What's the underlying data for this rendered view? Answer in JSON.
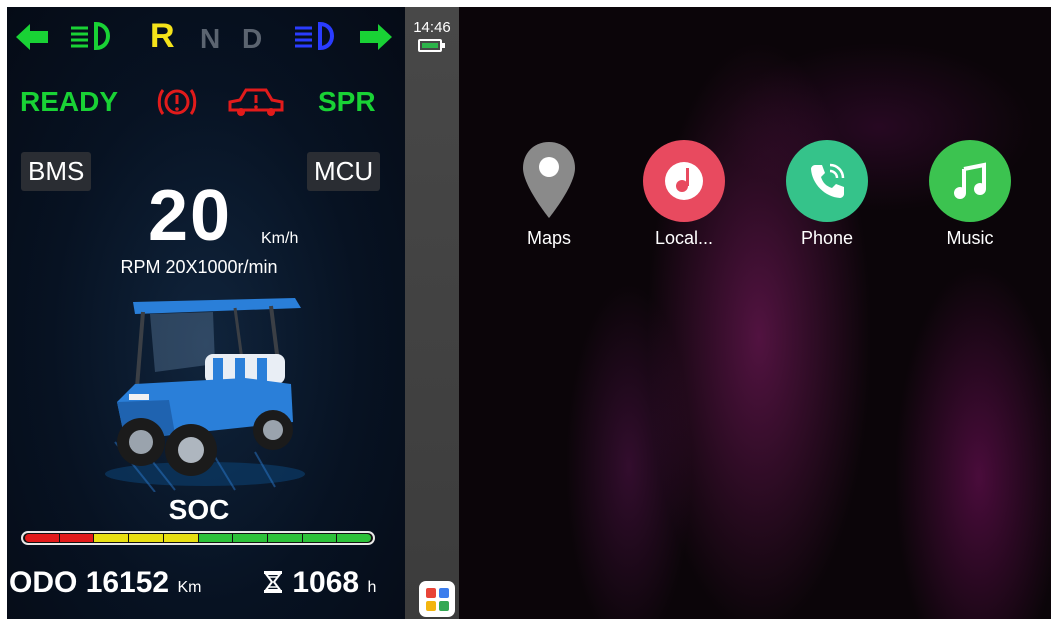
{
  "indicators": {
    "gear_r": "R",
    "gear_n": "N",
    "gear_d": "D"
  },
  "status": {
    "ready": "READY",
    "spr": "SPR"
  },
  "tags": {
    "bms": "BMS",
    "mcu": "MCU"
  },
  "speedometer": {
    "speed": "20",
    "unit": "Km/h",
    "rpm": "RPM 20X1000r/min"
  },
  "soc": {
    "label": "SOC",
    "segments": [
      "#e21b1b",
      "#e21b1b",
      "#e8df12",
      "#e8df12",
      "#e8df12",
      "#2dc23a",
      "#2dc23a",
      "#2dc23a",
      "#2dc23a",
      "#2dc23a"
    ]
  },
  "odometer": {
    "label": "ODO",
    "value": "16152",
    "unit": "Km"
  },
  "hours": {
    "icon": "hourglass-icon",
    "value": "1068",
    "unit": "h"
  },
  "side_strip": {
    "time": "14:46"
  },
  "apps": [
    {
      "label": "Maps",
      "icon": "map-pin-icon",
      "color": "#8a8a8a"
    },
    {
      "label": "Local...",
      "icon": "music-note-icon",
      "color": "#e84a5f"
    },
    {
      "label": "Phone",
      "icon": "phone-icon",
      "color": "#35c38a"
    },
    {
      "label": "Music",
      "icon": "music-icon",
      "color": "#3cc350"
    }
  ],
  "colors": {
    "indicator_green": "#19d235",
    "gear_active": "#f5e31a",
    "gear_inactive": "#5b6470",
    "warning_red": "#e21b1b",
    "headlight_blue": "#2a3cff"
  }
}
